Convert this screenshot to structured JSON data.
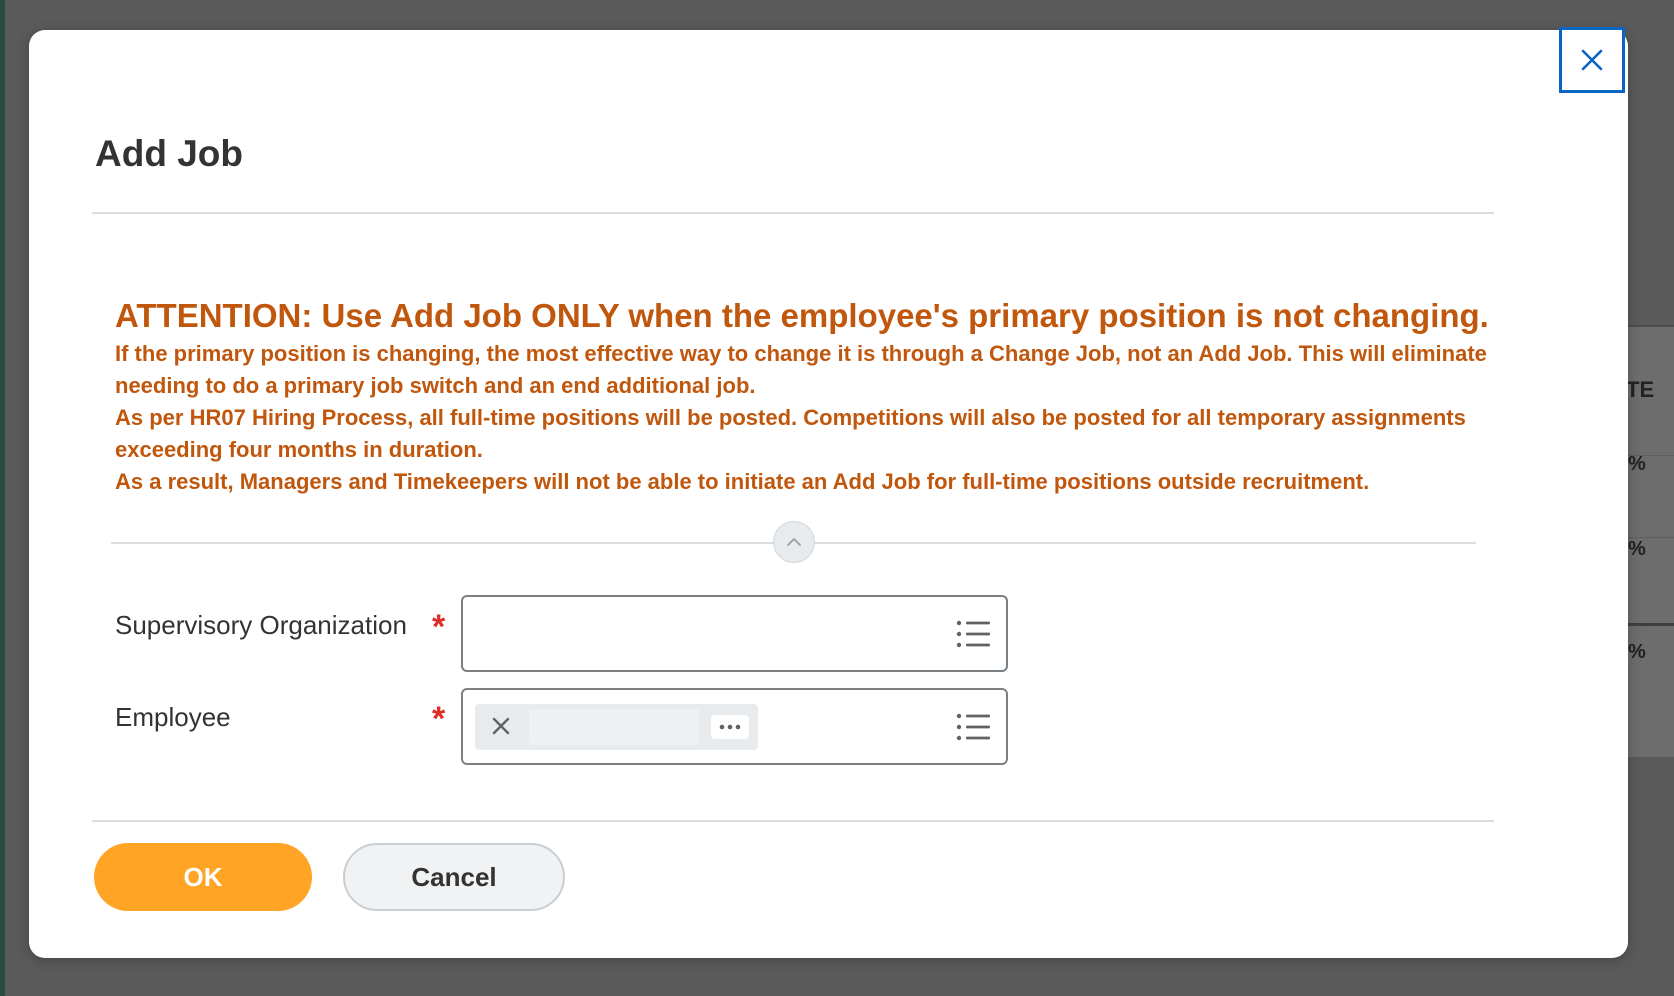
{
  "background": {
    "table_header": "TE",
    "cells": [
      "%",
      "%",
      "%"
    ]
  },
  "dialog": {
    "title": "Add Job",
    "close_icon": "close-icon",
    "attention": {
      "heading": "ATTENTION: Use Add Job ONLY when the employee's primary position is not changing.",
      "lines": [
        "If the primary position is changing, the most effective way to change it is through a Change Job, not an Add Job. This will eliminate needing to do a primary job switch and an end additional job.",
        "As per HR07 Hiring Process, all full-time positions will be posted. Competitions will also be posted for all temporary assignments exceeding four months in duration.",
        "As a result, Managers and Timekeepers will not be able to initiate an Add Job for full-time positions outside recruitment."
      ],
      "color": "#c0570d"
    },
    "collapse_icon": "chevron-up-icon",
    "fields": {
      "supervisory_organization": {
        "label": "Supervisory Organization",
        "required_marker": "*",
        "value": ""
      },
      "employee": {
        "label": "Employee",
        "required_marker": "*",
        "selected_value": "",
        "remove_icon": "close-icon",
        "more_icon": "ellipsis-icon"
      }
    },
    "buttons": {
      "ok": "OK",
      "cancel": "Cancel"
    },
    "colors": {
      "primary_button": "#ffa424",
      "focus_outline": "#0b65c2",
      "required": "#de2d26"
    }
  }
}
